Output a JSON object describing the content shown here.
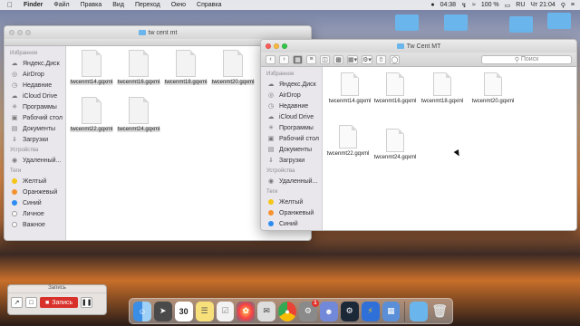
{
  "menubar": {
    "app": "Finder",
    "items": [
      "Файл",
      "Правка",
      "Вид",
      "Переход",
      "Окно",
      "Справка"
    ],
    "battery": "100 %",
    "lang": "RU",
    "clock": "Чт 21:04",
    "timer": "04:38"
  },
  "back_window": {
    "title": "tw cent mt",
    "sidebar": {
      "favorites_title": "Избранное",
      "favorites": [
        "Яндекс.Диск",
        "AirDrop",
        "Недавние",
        "iCloud Drive",
        "Программы",
        "Рабочий стол",
        "Документы",
        "Загрузки"
      ],
      "devices_title": "Устройства",
      "devices": [
        "Удаленный..."
      ],
      "tags_title": "Теги",
      "tags": [
        {
          "label": "Желтый",
          "color": "#f5c518"
        },
        {
          "label": "Оранжевый",
          "color": "#f5922f"
        },
        {
          "label": "Синий",
          "color": "#2e8cf0"
        },
        {
          "label": "Личное",
          "color": "#ffffff"
        },
        {
          "label": "Важное",
          "color": "#ffffff"
        }
      ]
    },
    "files": [
      "twcenmt14.gqxml",
      "twcenmt16.gqxml",
      "twcenmt18.gqxml",
      "twcenmt20.gqxml",
      "twcenmt22.gqxml",
      "twcenmt24.gqxml"
    ]
  },
  "front_window": {
    "title": "Tw Cent MT",
    "search_placeholder": "Поиск",
    "sidebar": {
      "favorites_title": "Избранное",
      "favorites": [
        {
          "label": "Яндекс.Диск",
          "icon": "cloud-icon"
        },
        {
          "label": "AirDrop",
          "icon": "airdrop-icon"
        },
        {
          "label": "Недавние",
          "icon": "clock-icon"
        },
        {
          "label": "iCloud Drive",
          "icon": "icloud-icon"
        },
        {
          "label": "Программы",
          "icon": "apps-icon"
        },
        {
          "label": "Рабочий стол",
          "icon": "desktop-icon"
        },
        {
          "label": "Документы",
          "icon": "documents-icon"
        },
        {
          "label": "Загрузки",
          "icon": "downloads-icon"
        }
      ],
      "devices_title": "Устройства",
      "devices": [
        "Удаленный..."
      ],
      "tags_title": "Теги",
      "tags": [
        {
          "label": "Желтый",
          "color": "#f5c518"
        },
        {
          "label": "Оранжевый",
          "color": "#f5922f"
        },
        {
          "label": "Синий",
          "color": "#2e8cf0"
        }
      ]
    },
    "files": [
      "twcenmt14.gqxml",
      "twcenmt16.gqxml",
      "twcenmt18.gqxml",
      "twcenmt20.gqxml",
      "twcenmt22.gqxml",
      "twcenmt24.gqxml"
    ]
  },
  "recorder": {
    "title": "Запись",
    "record_label": "Запись"
  },
  "dock": {
    "calendar_day": "30",
    "badge_count": "1"
  }
}
